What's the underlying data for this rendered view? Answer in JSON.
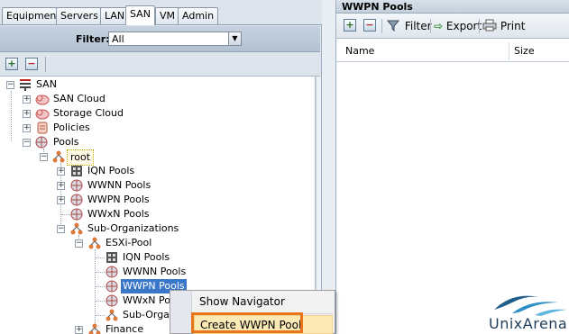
{
  "tabs": [
    "Equipment",
    "Servers",
    "LAN",
    "SAN",
    "VM",
    "Admin"
  ],
  "active_tab": "SAN",
  "filter": {
    "label": "Filter:",
    "value": "All"
  },
  "left_toolbar": {
    "expand": "+",
    "collapse": "−"
  },
  "tree": {
    "root": "SAN",
    "san_cloud": "SAN Cloud",
    "storage_cloud": "Storage Cloud",
    "policies": "Policies",
    "pools": "Pools",
    "root_org": "root",
    "iqn_pools": "IQN Pools",
    "wwnn_pools": "WWNN Pools",
    "wwpn_pools": "WWPN Pools",
    "wwxn_pools": "WWxN Pools",
    "sub_orgs": "Sub-Organizations",
    "esxi_pool": "ESXi-Pool",
    "esxi_iqn": "IQN Pools",
    "esxi_wwnn": "WWNN Pools",
    "esxi_wwpn": "WWPN Pools",
    "esxi_wwxn": "WWxN Po",
    "esxi_sub": "Sub-Organ",
    "finance": "Finance"
  },
  "right": {
    "title": "WWPN Pools",
    "add": "+",
    "remove": "−",
    "filter": "Filter",
    "export": "Export",
    "print": "Print",
    "columns": [
      "Name",
      "Size"
    ]
  },
  "context_menu": {
    "items": [
      "Show Navigator",
      "Create WWPN Pool"
    ],
    "highlighted": "Create WWPN Pool"
  },
  "logo": {
    "text": "UnixArena"
  },
  "colors": {
    "accent": "#e8751a",
    "selection": "#3b77c8",
    "header": "#c3cfdb"
  }
}
